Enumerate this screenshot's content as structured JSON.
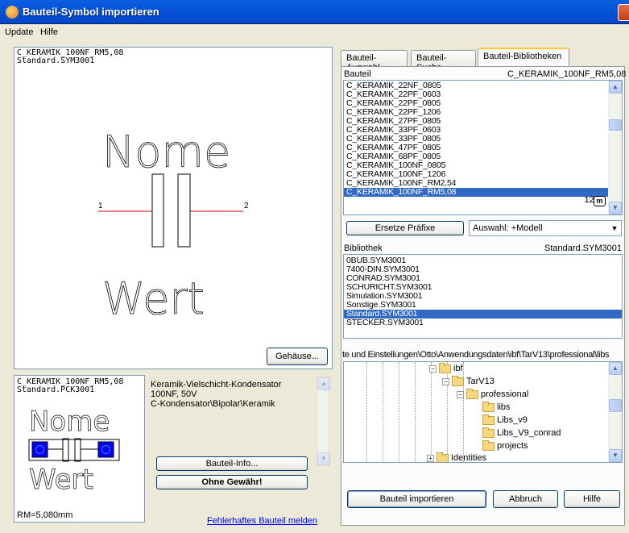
{
  "window": {
    "title": "Bauteil-Symbol importieren"
  },
  "menu": {
    "items": [
      "Update",
      "Hilfe"
    ]
  },
  "symbol_preview": {
    "component": "C_KERAMIK_100NF_RM5,08",
    "library": "Standard.SYM3001",
    "name_text": "Nome",
    "value_text": "Wert",
    "pin1": "1",
    "pin2": "2"
  },
  "package_button": "Gehäuse...",
  "package_preview": {
    "component": "C_KERAMIK_100NF_RM5,08",
    "library": "Standard.PCK3001",
    "name_text": "Nome",
    "value_text": "Wert",
    "grid": "RM=5,080mm"
  },
  "description": {
    "line1": "Keramik-Vielschicht-Kondensator 100NF, 50V",
    "line2": "C-Kondensator\\Bipolar\\Keramik"
  },
  "buttons": {
    "info": "Bauteil-Info...",
    "no_warranty": "Ohne Gewähr!",
    "report": "Fehlerhaftes Bauteil melden",
    "replace_prefix": "Ersetze Präfixe",
    "import": "Bauteil importieren",
    "cancel": "Abbruch",
    "help": "Hilfe"
  },
  "tabs": [
    "Bauteil-Auswahl",
    "Bauteil-Suche",
    "Bauteil-Bibliotheken"
  ],
  "bauteil_list": {
    "header": "Bauteil",
    "selected_name": "C_KERAMIK_100NF_RM5,08",
    "count": "1293",
    "count_icon": "m",
    "items": [
      "C_KERAMIK_22NF_0805",
      "C_KERAMIK_22PF_0603",
      "C_KERAMIK_22PF_0805",
      "C_KERAMIK_22PF_1206",
      "C_KERAMIK_27PF_0805",
      "C_KERAMIK_33PF_0603",
      "C_KERAMIK_33PF_0805",
      "C_KERAMIK_47PF_0805",
      "C_KERAMIK_68PF_0805",
      "C_KERAMIK_100NF_0805",
      "C_KERAMIK_100NF_1206",
      "C_KERAMIK_100NF_RM2,54",
      "C_KERAMIK_100NF_RM5,08"
    ],
    "selected_index": 12
  },
  "auswahl_combo": "Auswahl: +Modell",
  "bibliothek_list": {
    "header": "Bibliothek",
    "selected_name": "Standard.SYM3001",
    "items": [
      "0BUB.SYM3001",
      "7400-DIN.SYM3001",
      "CONRAD.SYM3001",
      "SCHURICHT.SYM3001",
      "Simulation.SYM3001",
      "Sonstige.SYM3001",
      "Standard.SYM3001",
      "STECKER.SYM3001"
    ],
    "selected_index": 6
  },
  "path_label": "te und Einstellungen\\Otto\\Anwendungsdaten\\ibf\\TarV13\\professional\\libs",
  "tree": {
    "nodes": [
      {
        "label": "ibf",
        "expander": "−"
      },
      {
        "label": "TarV13",
        "expander": "−"
      },
      {
        "label": "professional",
        "expander": "−"
      },
      {
        "label": "libs",
        "expander": ""
      },
      {
        "label": "Libs_v9",
        "expander": ""
      },
      {
        "label": "Libs_V9_conrad",
        "expander": ""
      },
      {
        "label": "projects",
        "expander": ""
      },
      {
        "label": "Identities",
        "expander": "+"
      }
    ]
  }
}
